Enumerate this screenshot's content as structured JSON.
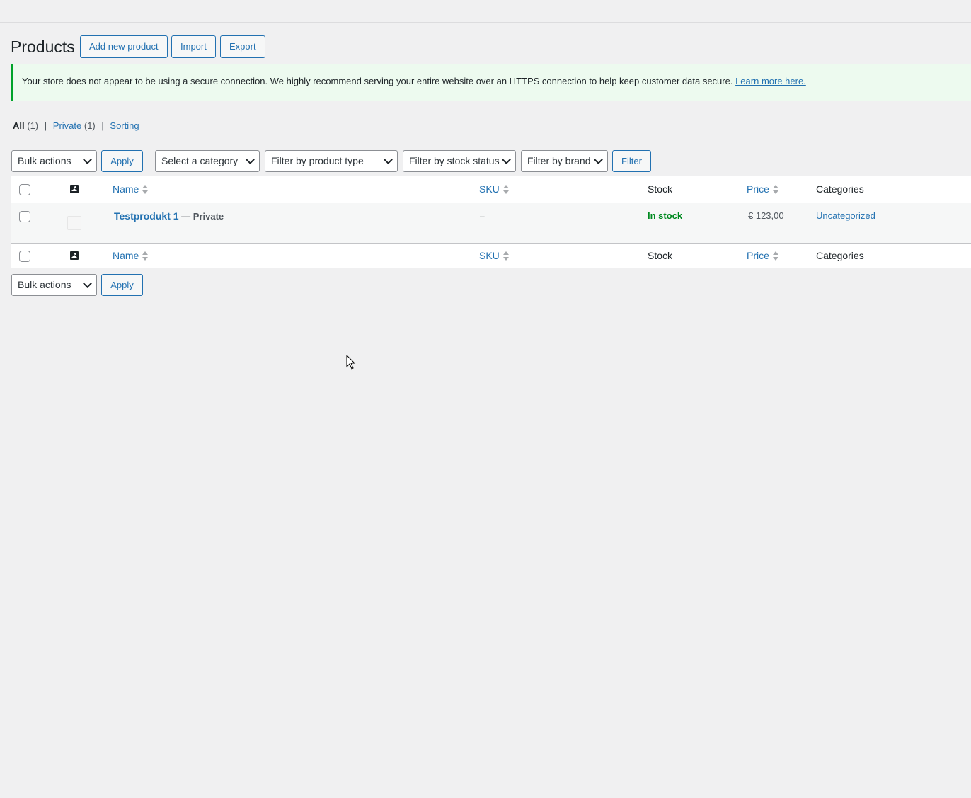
{
  "page": {
    "title": "Products",
    "actions": {
      "add_new": "Add new product",
      "import": "Import",
      "export": "Export"
    }
  },
  "notice": {
    "text": "Your store does not appear to be using a secure connection. We highly recommend serving your entire website over an HTTPS connection to help keep customer data secure.",
    "link": "Learn more here."
  },
  "views": {
    "all_label": "All",
    "all_count": "(1)",
    "private_label": "Private",
    "private_count": "(1)",
    "sorting_label": "Sorting",
    "separator": "|"
  },
  "filters": {
    "bulk_actions": "Bulk actions",
    "apply": "Apply",
    "category": "Select a category",
    "product_type": "Filter by product type",
    "stock_status": "Filter by stock status",
    "brand": "Filter by brand",
    "filter_button": "Filter"
  },
  "table": {
    "columns": {
      "name": "Name",
      "sku": "SKU",
      "stock": "Stock",
      "price": "Price",
      "categories": "Categories"
    },
    "rows": [
      {
        "name": "Testprodukt 1",
        "state": "— Private",
        "sku": "–",
        "stock": "In stock",
        "price": "€ 123,00",
        "category": "Uncategorized"
      }
    ]
  },
  "bottom": {
    "bulk_actions": "Bulk actions",
    "apply": "Apply"
  },
  "colors": {
    "accent": "#2271b1",
    "success": "#008a20",
    "notice_border": "#00a32a",
    "notice_bg": "#edfaef"
  }
}
